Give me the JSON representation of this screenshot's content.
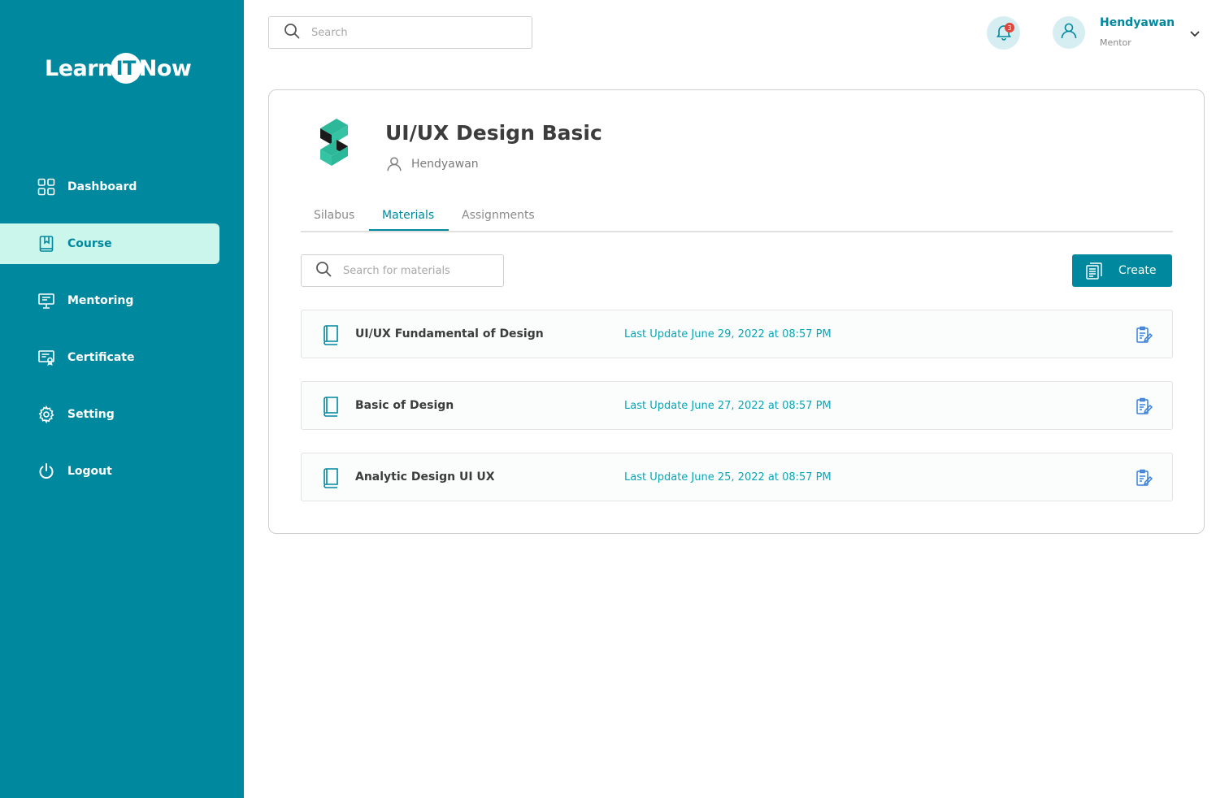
{
  "app": {
    "logo_left": "Learn",
    "logo_mid": "IT",
    "logo_right": "Now"
  },
  "sidebar": {
    "items": [
      {
        "label": "Dashboard",
        "icon": "grid-icon"
      },
      {
        "label": "Course",
        "icon": "bookmark-book-icon",
        "active": true
      },
      {
        "label": "Mentoring",
        "icon": "presentation-icon"
      },
      {
        "label": "Certificate",
        "icon": "certificate-icon"
      },
      {
        "label": "Setting",
        "icon": "gear-icon"
      },
      {
        "label": "Logout",
        "icon": "power-icon"
      }
    ]
  },
  "header": {
    "search_placeholder": "Search",
    "notification_count": "3",
    "user_name": "Hendyawan",
    "user_role": "Mentor"
  },
  "course": {
    "title": "UI/UX Design Basic",
    "author": "Hendyawan",
    "tabs": [
      "Silabus",
      "Materials",
      "Assignments"
    ],
    "active_tab": "Materials",
    "materials_search_placeholder": "Search for materials",
    "create_label": "Create",
    "materials": [
      {
        "title": "UI/UX Fundamental of Design",
        "updated": "Last Update June 29, 2022 at 08:57 PM"
      },
      {
        "title": "Basic of Design",
        "updated": "Last Update June 27, 2022 at 08:57 PM"
      },
      {
        "title": "Analytic Design UI UX",
        "updated": "Last Update June 25, 2022 at 08:57 PM"
      }
    ]
  },
  "colors": {
    "primary": "#00889e",
    "active_bg": "#cbf6ec",
    "date_text": "#0aa5b5",
    "badge": "#e0463b"
  }
}
